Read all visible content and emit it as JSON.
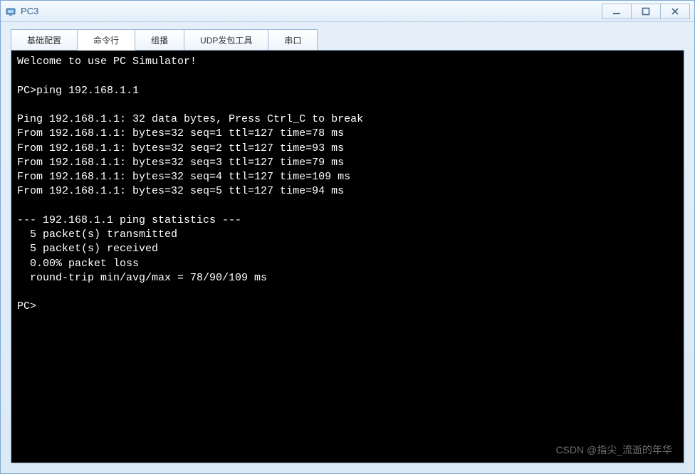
{
  "window": {
    "title": "PC3"
  },
  "tabs": {
    "basic_config": "基础配置",
    "command_line": "命令行",
    "multicast": "组播",
    "udp_tool": "UDP发包工具",
    "serial": "串口"
  },
  "terminal": {
    "welcome": "Welcome to use PC Simulator!",
    "prompt1": "PC>ping 192.168.1.1",
    "ping_header": "Ping 192.168.1.1: 32 data bytes, Press Ctrl_C to break",
    "reply1": "From 192.168.1.1: bytes=32 seq=1 ttl=127 time=78 ms",
    "reply2": "From 192.168.1.1: bytes=32 seq=2 ttl=127 time=93 ms",
    "reply3": "From 192.168.1.1: bytes=32 seq=3 ttl=127 time=79 ms",
    "reply4": "From 192.168.1.1: bytes=32 seq=4 ttl=127 time=109 ms",
    "reply5": "From 192.168.1.1: bytes=32 seq=5 ttl=127 time=94 ms",
    "stats_header": "--- 192.168.1.1 ping statistics ---",
    "stats_tx": "  5 packet(s) transmitted",
    "stats_rx": "  5 packet(s) received",
    "stats_loss": "  0.00% packet loss",
    "stats_rtt": "  round-trip min/avg/max = 78/90/109 ms",
    "prompt2": "PC>"
  },
  "watermark": "CSDN @指尖_流逝的年华"
}
